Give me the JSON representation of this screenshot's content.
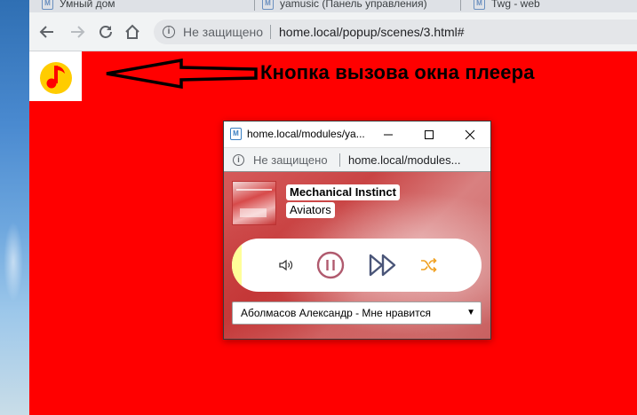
{
  "browser": {
    "tabs": [
      {
        "favicon": "M",
        "label": "Умный дом"
      },
      {
        "favicon": "M",
        "label": "yamusic (Панель управления)"
      },
      {
        "favicon": "M",
        "label": "Twg - web"
      }
    ],
    "address": {
      "security_label": "Не защищено",
      "url": "home.local/popup/scenes/3.html#"
    }
  },
  "page": {
    "player_button_icon": "yandex-music-icon",
    "annotation_text": "Кнопка вызова окна плеера"
  },
  "popup": {
    "favicon": "M",
    "title": "home.local/modules/ya...",
    "address": {
      "security_label": "Не защищено",
      "url": "home.local/modules..."
    },
    "player": {
      "track_title": "Mechanical Instinct",
      "track_artist": "Aviators",
      "progress": 0.04,
      "playlist_selected": "Аболмасов Александр - Мне нравится"
    }
  },
  "colors": {
    "page_background": "#ff0000",
    "pause_color": "#b05a6e",
    "next_color": "#4a5578",
    "shuffle_color": "#f0a020",
    "progress_color": "#ffff99"
  }
}
